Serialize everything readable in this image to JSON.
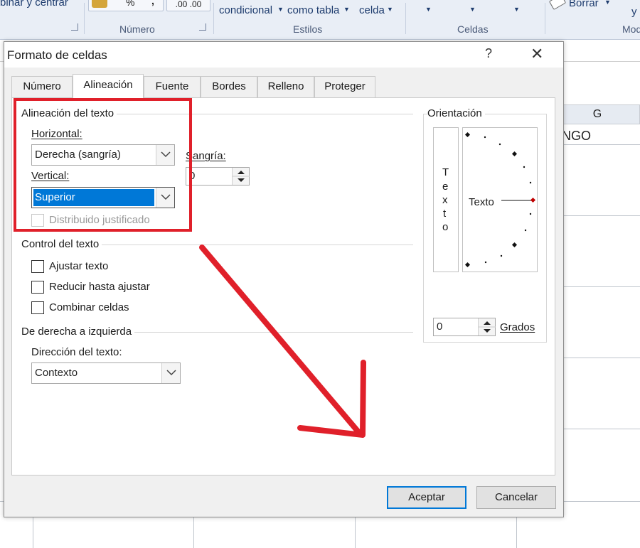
{
  "ribbon": {
    "merge_center_label": "binar y centrar",
    "percent_symbol": "%",
    "comma_symbol": ",",
    "decimal_label": ".00 .00",
    "conditional_label": "condicional",
    "as_table_label": "como tabla",
    "cell_label": "celda",
    "clear_label": "Borrar",
    "y_label": "y",
    "groups": {
      "number": "Número",
      "styles": "Estilos",
      "cells": "Celdas",
      "modify": "Mod"
    }
  },
  "sheet": {
    "column_g": "G",
    "cell_text": "NGO"
  },
  "dialog": {
    "title": "Formato de celdas",
    "help": "?",
    "close": "✕",
    "tabs": [
      "Número",
      "Alineación",
      "Fuente",
      "Bordes",
      "Relleno",
      "Proteger"
    ],
    "active_tab": "Alineación",
    "text_alignment": {
      "group_label": "Alineación del texto",
      "horizontal_label": "Horizontal:",
      "horizontal_value": "Derecha (sangría)",
      "vertical_label": "Vertical:",
      "vertical_value": "Superior",
      "indent_label": "Sangría:",
      "indent_value": "0",
      "distributed_label": "Distribuido justificado",
      "distributed_checked": false
    },
    "text_control": {
      "group_label": "Control del texto",
      "wrap_label": "Ajustar texto",
      "shrink_label": "Reducir hasta ajustar",
      "merge_label": "Combinar celdas"
    },
    "rtl": {
      "group_label": "De derecha a izquierda",
      "direction_label": "Dirección del texto:",
      "direction_value": "Contexto"
    },
    "orientation": {
      "group_label": "Orientación",
      "vertical_text": [
        "T",
        "e",
        "x",
        "t",
        "o"
      ],
      "text_label": "Texto",
      "degrees_value": "0",
      "degrees_label": "Grados"
    },
    "ok_label": "Aceptar",
    "cancel_label": "Cancelar"
  },
  "colors": {
    "highlight_red": "#e0202a",
    "selection_blue": "#0078d7"
  }
}
